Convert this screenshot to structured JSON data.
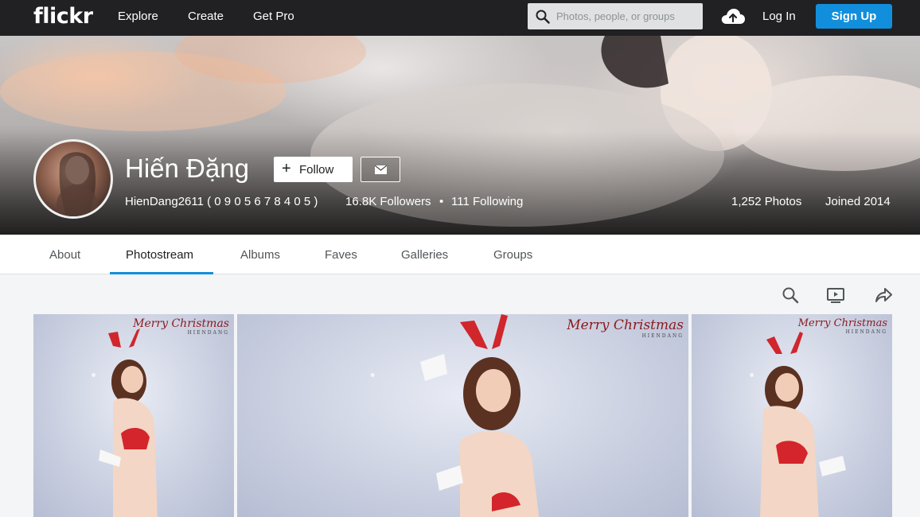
{
  "nav": {
    "logo": "flickr",
    "links": [
      "Explore",
      "Create",
      "Get Pro"
    ],
    "search_placeholder": "Photos, people, or groups",
    "login": "Log In",
    "signup": "Sign Up"
  },
  "profile": {
    "name": "Hiến Đặng",
    "follow_label": "Follow",
    "username": "HienDang2611 ( 0 9 0 5 6 7 8 4 0 5 )",
    "followers": "16.8K Followers",
    "separator": "•",
    "following": "111 Following",
    "photos": "1,252 Photos",
    "joined": "Joined 2014"
  },
  "tabs": [
    "About",
    "Photostream",
    "Albums",
    "Faves",
    "Galleries",
    "Groups"
  ],
  "active_tab": "Photostream",
  "toolbar_icons": [
    "search-icon",
    "slideshow-icon",
    "share-icon"
  ],
  "photos": [
    {
      "caption": "Merry Christmas",
      "sub": "HIENDANG"
    },
    {
      "caption": "Merry Christmas",
      "sub": "HIENDANG"
    },
    {
      "caption": "Merry Christmas",
      "sub": "HIENDANG"
    }
  ],
  "colors": {
    "accent": "#128fdc",
    "nav_bg": "#212124"
  }
}
